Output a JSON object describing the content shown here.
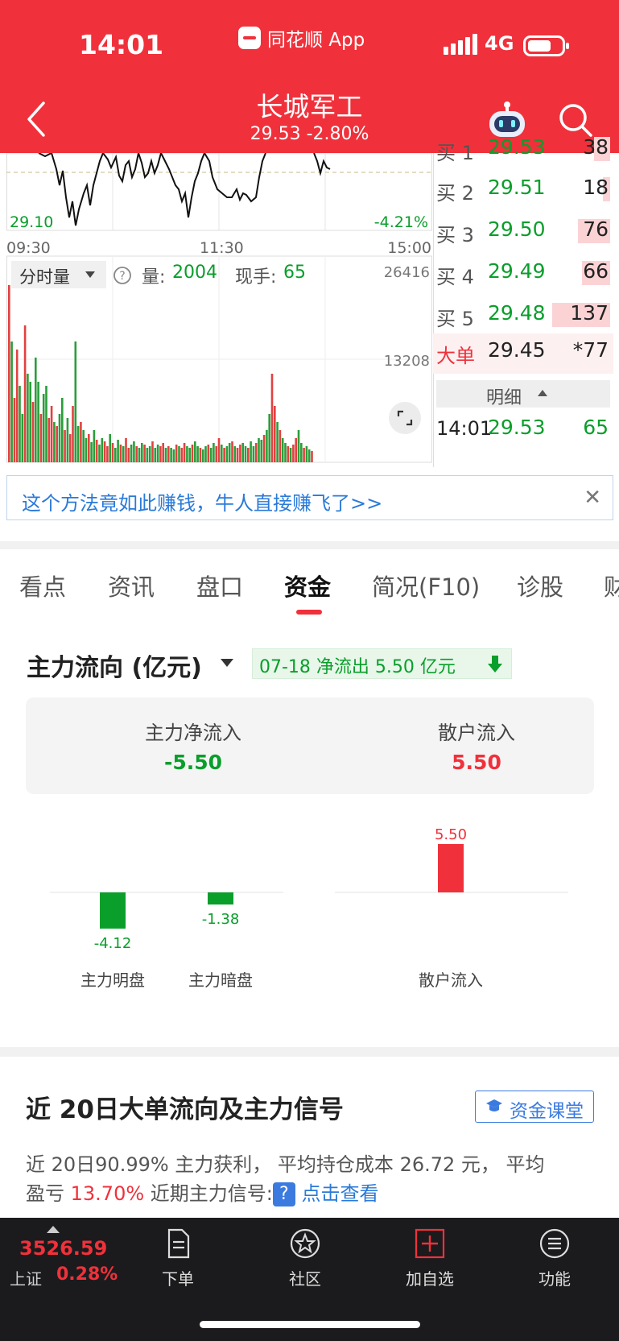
{
  "status_bar": {
    "time": "14:01",
    "app_name": "同花顺 App",
    "network": "4G"
  },
  "header": {
    "title": "长城军工",
    "subtitle": "29.53 -2.80%"
  },
  "intraday": {
    "low_label": "29.10",
    "low_pct": "-4.21%",
    "time_start": "09:30",
    "time_mid": "11:30",
    "time_end": "15:00",
    "vol_dropdown": "分时量",
    "vol_label": "量:",
    "vol_value": "2004",
    "hand_label": "现手:",
    "hand_value": "65",
    "vol_axis_top": "26416",
    "vol_axis_mid": "13208"
  },
  "orderbook": {
    "bids": [
      {
        "label": "买 1",
        "price": "29.53",
        "volume": "38",
        "vol_ratio": 0.28
      },
      {
        "label": "买 2",
        "price": "29.51",
        "volume": "18",
        "vol_ratio": 0.13
      },
      {
        "label": "买 3",
        "price": "29.50",
        "volume": "76",
        "vol_ratio": 0.55
      },
      {
        "label": "买 4",
        "price": "29.49",
        "volume": "66",
        "vol_ratio": 0.48
      },
      {
        "label": "买 5",
        "price": "29.48",
        "volume": "137",
        "vol_ratio": 1.0
      }
    ],
    "big_order": {
      "label": "大单",
      "price": "29.45",
      "volume": "*77"
    },
    "detail_label": "明细",
    "tick": {
      "time": "14:01",
      "price": "29.53",
      "volume": "65"
    }
  },
  "ad": {
    "text": "这个方法竟如此赚钱，牛人直接赚飞了>>"
  },
  "tabs": [
    {
      "label": "看点"
    },
    {
      "label": "资讯"
    },
    {
      "label": "盘口"
    },
    {
      "label": "资金",
      "active": true
    },
    {
      "label": "简况(F10)"
    },
    {
      "label": "诊股"
    },
    {
      "label": "财"
    }
  ],
  "fund_flow": {
    "title": "主力流向 (亿元)",
    "badge": "07-18 净流出 5.50 亿元",
    "main_net_label": "主力净流入",
    "main_net_value": "-5.50",
    "retail_label": "散户流入",
    "retail_value": "5.50",
    "colors": {
      "up": "#f0313b",
      "down": "#0a9e2b"
    }
  },
  "chart_data": {
    "type": "bar",
    "categories": [
      "主力明盘",
      "主力暗盘",
      "散户流入"
    ],
    "values": [
      -4.12,
      -1.38,
      5.5
    ],
    "value_labels": [
      "-4.12",
      "-1.38",
      "5.50"
    ],
    "title": "",
    "xlabel": "",
    "ylabel": ""
  },
  "signals": {
    "title": "近 20日大单流向及主力信号",
    "button_label": "资金课堂",
    "line1": "近 20日90.99% 主力获利， 平均持仓成本 26.72 元， 平均",
    "line2_prefix": "盈亏 ",
    "line2_pct": "13.70%",
    "line2_mid": " 近期主力信号:",
    "line2_qmark": "?",
    "line2_link": "点击查看"
  },
  "bottom_nav": {
    "index_value": "3526.59",
    "index_name": "上证",
    "index_pct": "0.28%",
    "items": [
      {
        "label": "下单"
      },
      {
        "label": "社区"
      },
      {
        "label": "加自选"
      },
      {
        "label": "功能"
      }
    ]
  }
}
